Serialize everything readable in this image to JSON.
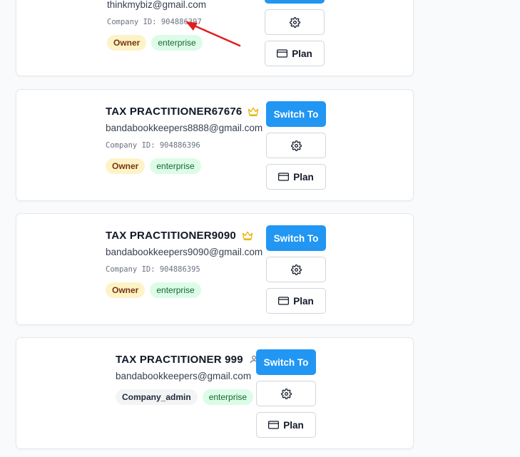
{
  "cards": [
    {
      "email": "thinkmybiz@gmail.com",
      "company_id": "Company ID: 904886397",
      "role": "Owner",
      "plan": "enterprise",
      "settings_icon": "gear-icon",
      "plan_label": "Plan",
      "plan_icon": "credit-card-icon"
    },
    {
      "name": "TAX PRACTITIONER67676",
      "email": "bandabookkeepers8888@gmail.com",
      "company_id": "Company ID: 904886396",
      "role": "Owner",
      "plan": "enterprise",
      "role_icon": "crown-icon",
      "switch_label": "Switch To",
      "settings_icon": "gear-icon",
      "plan_label": "Plan",
      "plan_icon": "credit-card-icon"
    },
    {
      "name": "TAX PRACTITIONER9090",
      "email": "bandabookkeepers9090@gmail.com",
      "company_id": "Company ID: 904886395",
      "role": "Owner",
      "plan": "enterprise",
      "role_icon": "crown-icon",
      "switch_label": "Switch To",
      "settings_icon": "gear-icon",
      "plan_label": "Plan",
      "plan_icon": "credit-card-icon"
    },
    {
      "name": "TAX PRACTITIONER 999",
      "email": "bandabookkeepers@gmail.com",
      "role": "Company_admin",
      "plan": "enterprise",
      "role_icon": "user-icon",
      "switch_label": "Switch To",
      "settings_icon": "gear-icon",
      "plan_label": "Plan",
      "plan_icon": "credit-card-icon"
    }
  ],
  "colors": {
    "accent": "#2196f3",
    "owner_badge_bg": "#fef3c7",
    "enterprise_badge_bg": "#dcfce7",
    "crown": "#eab308",
    "annotation_arrow": "#e11d1d"
  }
}
